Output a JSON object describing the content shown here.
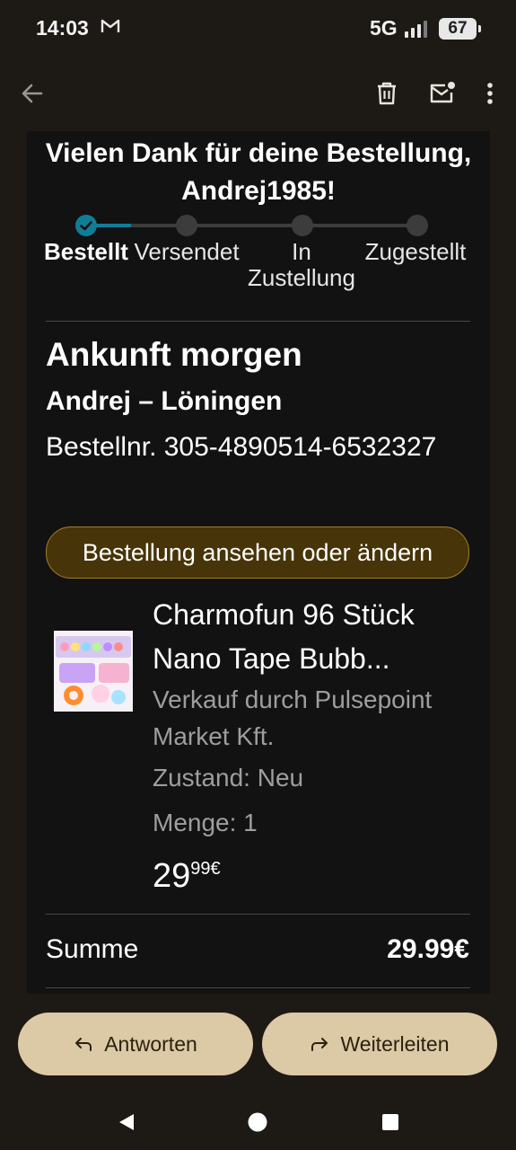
{
  "status_bar": {
    "time": "14:03",
    "network": "5G",
    "battery": "67"
  },
  "email": {
    "heading": "Vielen Dank für deine Bestellung, Andrej1985!",
    "steps": [
      "Bestellt",
      "Versendet",
      "In Zustellung",
      "Zugestellt"
    ],
    "current_step": "Bestellt",
    "arrival": "Ankunft morgen",
    "recipient": "Andrej – Löningen",
    "order_number": "Bestellnr. 305-4890514-6532327",
    "order_button": "Bestellung ansehen oder ändern",
    "product": {
      "title": "Charmofun 96 Stück Nano Tape Bubb...",
      "seller": "Verkauf durch Pulsepoint Market Kft.",
      "condition": "Zustand: Neu",
      "quantity": "Menge: 1",
      "price_whole": "29",
      "price_fraction": "99€"
    },
    "total_label": "Summe",
    "total_value": "29.99€"
  },
  "actions": {
    "reply": "Antworten",
    "forward": "Weiterleiten"
  },
  "colors": {
    "accent": "#0f7d98",
    "button_fill": "#473408",
    "button_border": "#a07e2a",
    "action_fill": "#dcc9a6"
  },
  "icons": [
    "back-arrow-icon",
    "delete-icon",
    "mark-unread-icon",
    "more-vert-icon",
    "reply-icon",
    "forward-icon",
    "checkmark-icon",
    "gmail-icon",
    "signal-icon",
    "battery-icon"
  ]
}
